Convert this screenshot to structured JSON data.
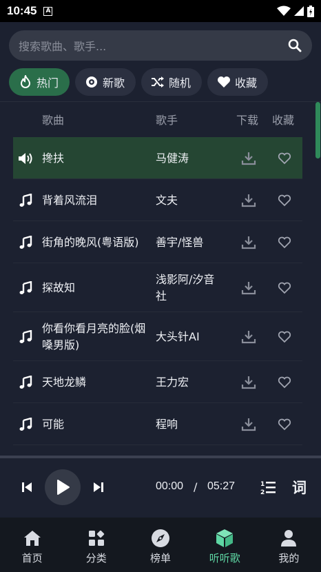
{
  "status_bar": {
    "time": "10:45"
  },
  "search": {
    "placeholder": "搜索歌曲、歌手..."
  },
  "tabs": [
    {
      "label": "热门",
      "icon": "fire-icon",
      "active": true
    },
    {
      "label": "新歌",
      "icon": "disc-icon",
      "active": false
    },
    {
      "label": "随机",
      "icon": "shuffle-icon",
      "active": false
    },
    {
      "label": "收藏",
      "icon": "heart-icon",
      "active": false
    }
  ],
  "list_header": {
    "song": "歌曲",
    "artist": "歌手",
    "download": "下载",
    "favorite": "收藏"
  },
  "songs": [
    {
      "title": "搀扶",
      "artist": "马健涛",
      "playing": true
    },
    {
      "title": "背着风流泪",
      "artist": "文夫",
      "playing": false
    },
    {
      "title": "街角的晚风(粤语版)",
      "artist": "善宇/怪兽",
      "playing": false
    },
    {
      "title": "探故知",
      "artist": "浅影阿/汐音社",
      "playing": false
    },
    {
      "title": "你看你看月亮的脸(烟嗓男版)",
      "artist": "大头针AI",
      "playing": false
    },
    {
      "title": "天地龙鳞",
      "artist": "王力宏",
      "playing": false
    },
    {
      "title": "可能",
      "artist": "程响",
      "playing": false
    }
  ],
  "player": {
    "current_time": "00:00",
    "separator": "/",
    "total_time": "05:27",
    "lyrics_label": "词"
  },
  "nav": [
    {
      "label": "首页",
      "icon": "home-icon",
      "active": false
    },
    {
      "label": "分类",
      "icon": "category-icon",
      "active": false
    },
    {
      "label": "榜单",
      "icon": "compass-icon",
      "active": false
    },
    {
      "label": "听听歌",
      "icon": "cube-icon",
      "active": true
    },
    {
      "label": "我的",
      "icon": "user-icon",
      "active": false
    }
  ],
  "colors": {
    "accent": "#5ed6a3",
    "active_tab": "#2a6e4a",
    "playing_row": "#254633",
    "background": "#1c2130"
  }
}
